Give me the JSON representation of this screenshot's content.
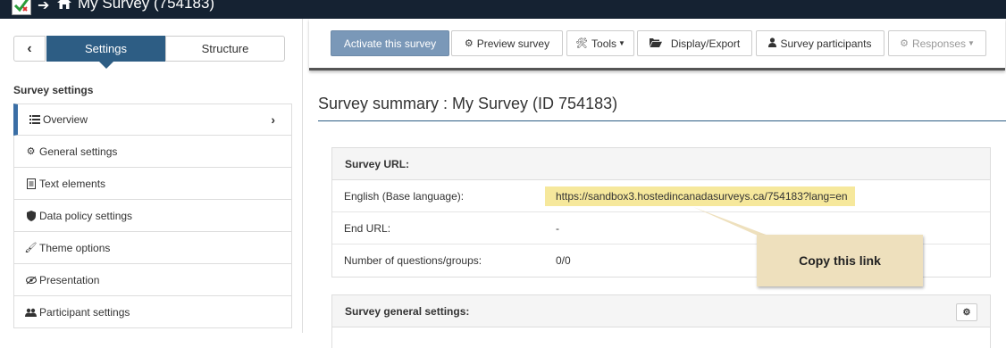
{
  "window": {
    "title": "My Survey (754183)"
  },
  "sidebar": {
    "tabs": {
      "settings": "Settings",
      "structure": "Structure"
    },
    "section_label": "Survey settings",
    "items": [
      {
        "label": "Overview",
        "icon": "list-icon",
        "active": true
      },
      {
        "label": "General settings",
        "icon": "cogs-icon"
      },
      {
        "label": "Text elements",
        "icon": "file-text-icon"
      },
      {
        "label": "Data policy settings",
        "icon": "shield-icon"
      },
      {
        "label": "Theme options",
        "icon": "paintbrush-icon"
      },
      {
        "label": "Presentation",
        "icon": "eye-slash-icon"
      },
      {
        "label": "Participant settings",
        "icon": "users-icon"
      }
    ]
  },
  "toolbar": {
    "activate": "Activate this survey",
    "preview": "Preview survey",
    "tools": "Tools",
    "display_export": "Display/Export",
    "participants": "Survey participants",
    "responses": "Responses"
  },
  "summary": {
    "title": "Survey summary : My Survey (ID 754183)",
    "url_panel": {
      "heading": "Survey URL:",
      "rows": [
        {
          "label": "English (Base language):",
          "value": "https://sandbox3.hostedincanadasurveys.ca/754183?lang=en"
        },
        {
          "label": "End URL:",
          "value": "-"
        },
        {
          "label": "Number of questions/groups:",
          "value": "0/0"
        }
      ]
    },
    "general_panel": {
      "heading": "Survey general settings:"
    }
  },
  "callout": {
    "text": "Copy this link"
  },
  "colors": {
    "topbar": "#152232",
    "accent": "#2d5d84",
    "highlight": "#f6e89c",
    "callout": "#eee0bd"
  }
}
